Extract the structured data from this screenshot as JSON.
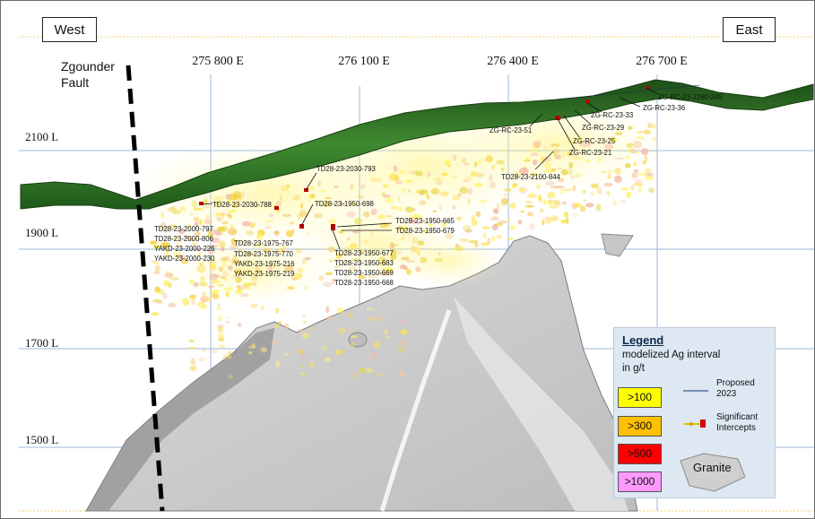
{
  "directions": {
    "west": "West",
    "east": "East"
  },
  "fault": {
    "line1": "Zgounder",
    "line2": "Fault"
  },
  "eastings": [
    "275 800 E",
    "276 100 E",
    "276 400 E",
    "276 700 E"
  ],
  "levels": [
    "2100 L",
    "1900 L",
    "1700 L",
    "1500 L"
  ],
  "drill_labels": [
    "ZG-RC-23-2260-245",
    "ZG-RC-23-36",
    "ZG-RC-23-33",
    "ZG-RC-23-29",
    "ZG-RC-23-51",
    "ZG-RC-23-25",
    "ZG-RC-23-21",
    "TD28-23-2100-844",
    "TD28-23-2030-793",
    "TD28-23-2030-788",
    "TD28-23-1950-698",
    "TD28-23-1950-665",
    "TD28-23-1950-679",
    "TD28-23-2000-797",
    "TD28-23-2000-806",
    "YAKD-23-2000-226",
    "YAKD-23-2000-230",
    "TD28-23-1975-767",
    "TD28-23-1975-770",
    "YAKD-23-1975-216",
    "YAKD-23-1975-219",
    "TD28-23-1950-677",
    "TD28-23-1950-683",
    "TD28-23-1950-669",
    "TD28-23-1950-668"
  ],
  "legend": {
    "title": "Legend",
    "subtitle_line1": "modelized Ag interval",
    "subtitle_line2": "in g/t",
    "grades": [
      {
        "label": ">100",
        "color": "#ffff00"
      },
      {
        "label": ">300",
        "color": "#ffc000"
      },
      {
        "label": ">500",
        "color": "#ff0000"
      },
      {
        "label": ">1000",
        "color": "#ff99ff"
      }
    ],
    "proposed": {
      "line1": "Proposed",
      "line2": "2023"
    },
    "significant": {
      "line1": "Significant",
      "line2": "Intercepts"
    },
    "granite": "Granite"
  },
  "colors": {
    "grid": "#9db7d8",
    "green_layer": "#2f6b25",
    "granite": "#c9c9c9",
    "legend_bg": "#dde8f3"
  }
}
